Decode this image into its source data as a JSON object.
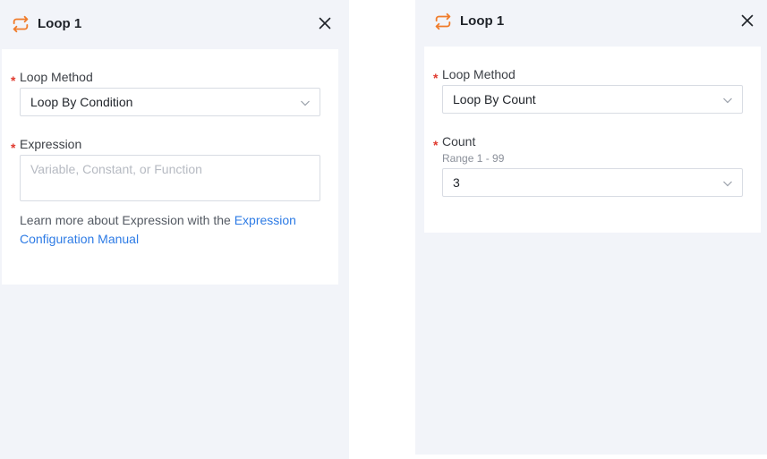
{
  "left_panel": {
    "title": "Loop 1",
    "loop_method": {
      "label": "Loop Method",
      "required_mark": "*",
      "value": "Loop By Condition"
    },
    "expression": {
      "label": "Expression",
      "required_mark": "*",
      "placeholder": "Variable, Constant, or Function",
      "value": ""
    },
    "help": {
      "text": "Learn more about Expression with the ",
      "link_part1": "Expression",
      "link_part2": "Configuration Manual"
    }
  },
  "right_panel": {
    "title": "Loop 1",
    "loop_method": {
      "label": "Loop Method",
      "required_mark": "*",
      "value": "Loop By Count"
    },
    "count": {
      "label": "Count",
      "required_mark": "*",
      "hint": "Range 1 - 99",
      "value": "3"
    }
  },
  "colors": {
    "accent_icon": "#f07c2b",
    "required": "#e03a2f",
    "link": "#2d7be5",
    "panel_bg": "#f2f4f9"
  },
  "icons": {
    "loop": "loop-refresh-icon",
    "close": "close-icon",
    "dropdown": "chevron-down-icon"
  }
}
